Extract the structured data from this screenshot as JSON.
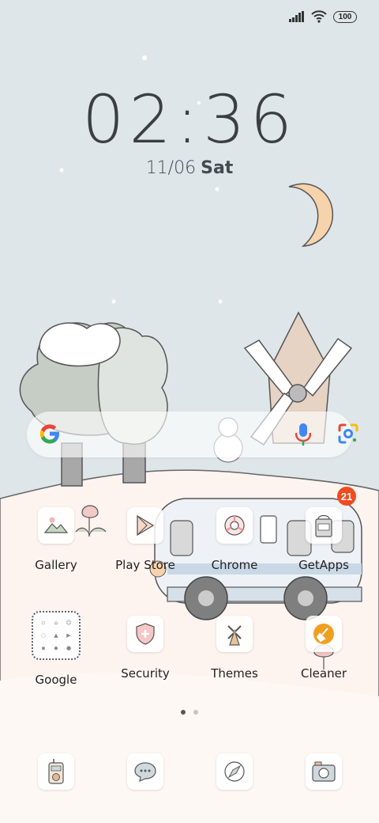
{
  "status_bar": {
    "signal_icon": "signal-icon",
    "wifi_icon": "wifi-icon",
    "battery_level": "100"
  },
  "lock": {
    "time": "02:36",
    "date": "11/06",
    "weekday": "Sat"
  },
  "search": {
    "icons": [
      "google-g-icon",
      "mic-icon",
      "lens-icon"
    ]
  },
  "apps": {
    "gallery": {
      "label": "Gallery"
    },
    "play_store": {
      "label": "Play Store"
    },
    "chrome": {
      "label": "Chrome"
    },
    "getapps": {
      "label": "GetApps",
      "badge": "21"
    },
    "google": {
      "label": "Google"
    },
    "security": {
      "label": "Security"
    },
    "themes": {
      "label": "Themes"
    },
    "cleaner": {
      "label": "Cleaner"
    }
  },
  "pager": {
    "current_page": 1,
    "total_pages": 2
  },
  "dock": [
    "phone-icon",
    "messages-icon",
    "browser-icon",
    "camera-icon"
  ],
  "colors": {
    "sky": "#dfe6ea",
    "ground": "#fdf3ef",
    "moon": "#f7d3ac",
    "badge": "#ef4b1f"
  }
}
